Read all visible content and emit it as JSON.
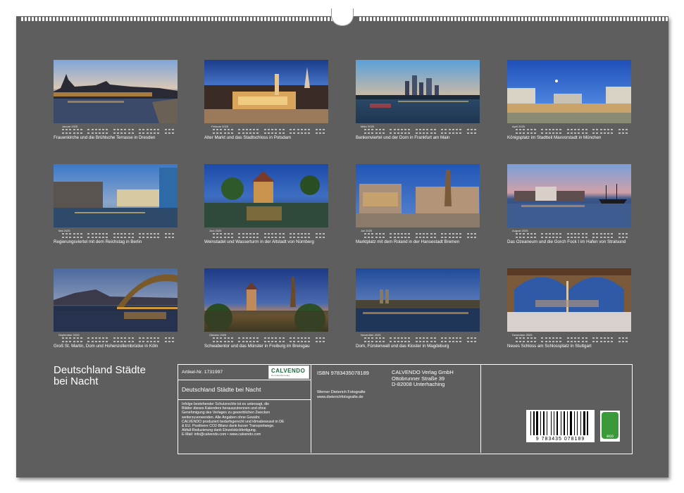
{
  "title": {
    "line1": "Deutschland   Städte",
    "line2": "bei Nacht"
  },
  "months": [
    {
      "month": "Januar 2025",
      "caption": "Frauenkirche und die Brühlsche Terrasse in Dresden"
    },
    {
      "month": "Februar 2025",
      "caption": "Alter Markt und das Stadtschloss in Potsdam"
    },
    {
      "month": "März 2025",
      "caption": "Bankenviertel und der Dom in Frankfurt am Main"
    },
    {
      "month": "April 2025",
      "caption": "Königsplatz im Stadtteil Maxvorstadt in München"
    },
    {
      "month": "Mai 2025",
      "caption": "Regierungsviertel mit dem Reichstag in Berlin"
    },
    {
      "month": "Juni 2025",
      "caption": "Weinstadel und Wasserturm in der Altstadt von Nürnberg"
    },
    {
      "month": "Juli 2025",
      "caption": "Marktplatz mit dem Roland in der Hansestadt Bremen"
    },
    {
      "month": "August 2025",
      "caption": "Das Ozeaneum und die Gorch Fock I im Hafen von Stralsund"
    },
    {
      "month": "September 2025",
      "caption": "Groß St. Martin, Dom und Hohenzollernbrücke in Köln"
    },
    {
      "month": "Oktober 2025",
      "caption": "Schwabentor und das Münster in Freiburg im Breisgau"
    },
    {
      "month": "November 2025",
      "caption": "Dom, Fürstenwall und das Kloster in Magdeburg"
    },
    {
      "month": "Dezember 2025",
      "caption": "Neues Schloss am Schlossplatz in Stuttgart"
    }
  ],
  "info": {
    "article": "Artikel-Nr. 1731997",
    "brand": "CALVENDO",
    "brand_sub": "Der Kalenderverlag",
    "product_title": "Deutschland   Städte bei Nacht",
    "legal": [
      "Infolge bestehender Schutzrechte ist es untersagt, die",
      "Blätter dieses Kalenders herauszutrennen und ohne",
      "Genehmigung des Verlages zu gewerblichen Zwecken",
      "weiterzuverwenden. Alle Angaben ohne Gewähr.",
      "CALVENDO produziert bedarfsgerecht und klimabewusst in DE",
      "& EU. Positivere CO2-Bilanz dank kurzer Transportwege.",
      "Abfall-Reduzierung dank Einzelstückfertigung.",
      "E-Mail: info@calvendo.com • www.calvendo.com"
    ],
    "isbn": "ISBN 9783435078189",
    "author": "Werner Dieterich Fotografie",
    "author_url": "www.dieterichfotografie.de",
    "publisher": [
      "CALVENDO Verlag GmbH",
      "Ottobrunner Straße 39",
      "D-82008 Unterhaching"
    ],
    "barcode_number": "9 783435 078189",
    "eco_label": "eco"
  },
  "colors": {
    "background": "#5e5e5e",
    "text": "#ffffff",
    "eco": "#3a9a3a"
  }
}
